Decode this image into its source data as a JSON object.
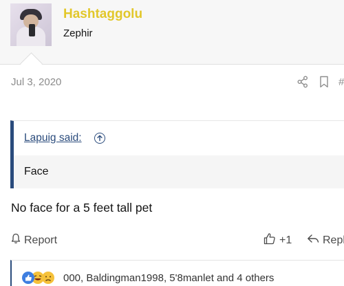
{
  "post": {
    "username": "Hashtaggolu",
    "user_title": "Zephir",
    "date": "Jul 3, 2020",
    "hash_symbol": "#",
    "quote": {
      "author": "Lapuig said:",
      "text": "Face"
    },
    "message": "No face for a 5 feet tall pet",
    "actions": {
      "report": "Report",
      "like": "+1",
      "reply": "Repl"
    },
    "reactions": {
      "summary": "000, Baldingman1998, 5'8manlet and 4 others",
      "icons": [
        "like-reaction",
        "laugh-reaction",
        "sad-reaction"
      ]
    }
  },
  "colors": {
    "username": "#e2c72a",
    "quote_bar": "#2a4b7c",
    "muted": "#8c8c8c"
  }
}
